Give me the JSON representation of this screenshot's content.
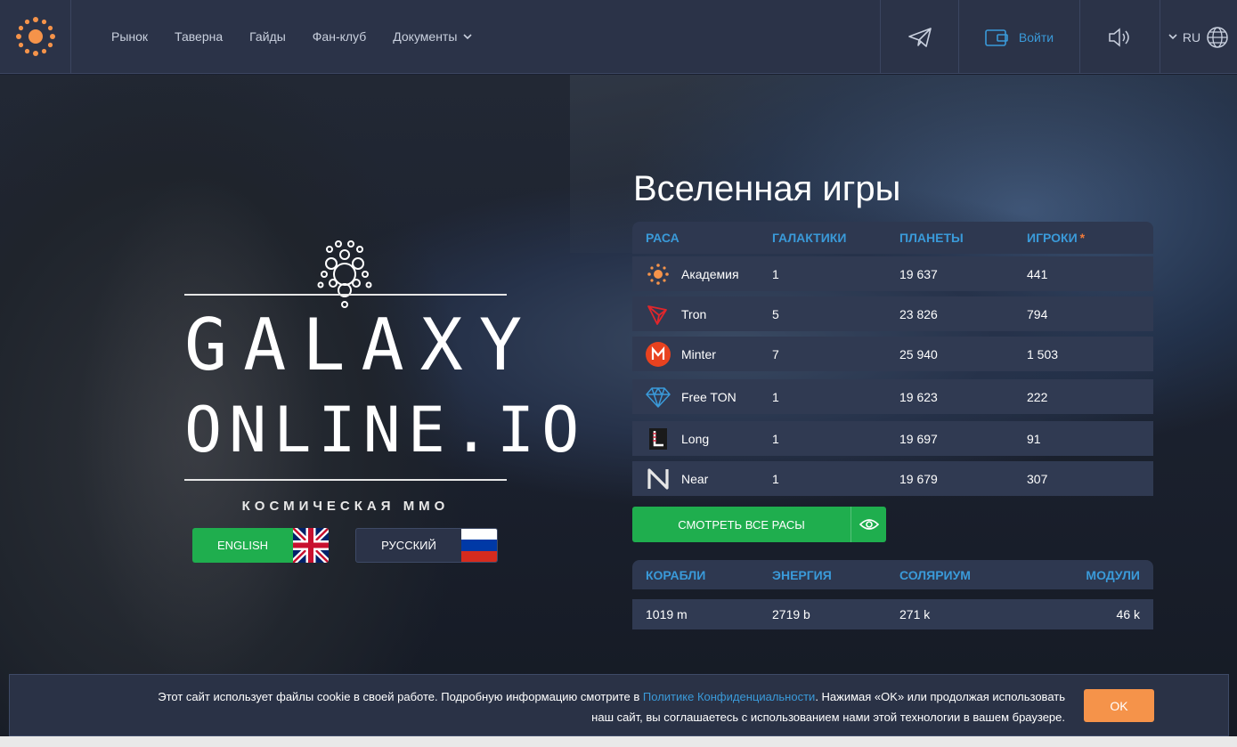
{
  "colors": {
    "accent": "#3a9ad9",
    "green": "#1fae4e",
    "orange": "#f5934a",
    "header_bg": "#2b3348"
  },
  "nav": {
    "items": [
      "Рынок",
      "Таверна",
      "Гайды",
      "Фан-клуб",
      "Документы"
    ]
  },
  "header": {
    "login_label": "Войти",
    "lang_code": "RU",
    "icons": [
      "telegram-icon",
      "wallet-icon",
      "sound-icon",
      "globe-icon"
    ]
  },
  "brand": {
    "line1": "GALAXY",
    "line2": "ONLINE.IO",
    "subtitle": "КОСМИЧЕСКАЯ ММО",
    "english_label": "ENGLISH",
    "russian_label": "РУССКИЙ"
  },
  "stats": {
    "title": "Вселенная игры",
    "race_headers": [
      "РАСА",
      "ГАЛАКТИКИ",
      "ПЛАНЕТЫ",
      "ИГРОКИ"
    ],
    "players_star": "*",
    "races": [
      {
        "name": "Академия",
        "galaxies": "1",
        "planets": "19 637",
        "players": "441",
        "icon": "academy-icon"
      },
      {
        "name": "Tron",
        "galaxies": "5",
        "planets": "23 826",
        "players": "794",
        "icon": "tron-icon"
      },
      {
        "name": "Minter",
        "galaxies": "7",
        "planets": "25 940",
        "players": "1 503",
        "icon": "minter-icon"
      },
      {
        "name": "Free TON",
        "galaxies": "1",
        "planets": "19 623",
        "players": "222",
        "icon": "free-ton-icon"
      },
      {
        "name": "Long",
        "galaxies": "1",
        "planets": "19 697",
        "players": "91",
        "icon": "long-icon"
      },
      {
        "name": "Near",
        "galaxies": "1",
        "planets": "19 679",
        "players": "307",
        "icon": "near-icon"
      }
    ],
    "see_all_label": "СМОТРЕТЬ ВСЕ РАСЫ",
    "resource_headers": [
      "КОРАБЛИ",
      "ЭНЕРГИЯ",
      "СОЛЯРИУМ",
      "МОДУЛИ"
    ],
    "resource_values": [
      "1019 m",
      "2719 b",
      "271 k",
      "46 k"
    ]
  },
  "cookie": {
    "text_before": "Этот сайт использует файлы cookie в своей работе. Подробную информацию смотрите в ",
    "link_text": "Политике Конфиденциальности",
    "text_after": ". Нажимая «OK» или продолжая использовать",
    "text_line2": "наш сайт, вы соглашаетесь с использованием нами этой технологии в вашем браузере.",
    "ok_label": "OK"
  }
}
